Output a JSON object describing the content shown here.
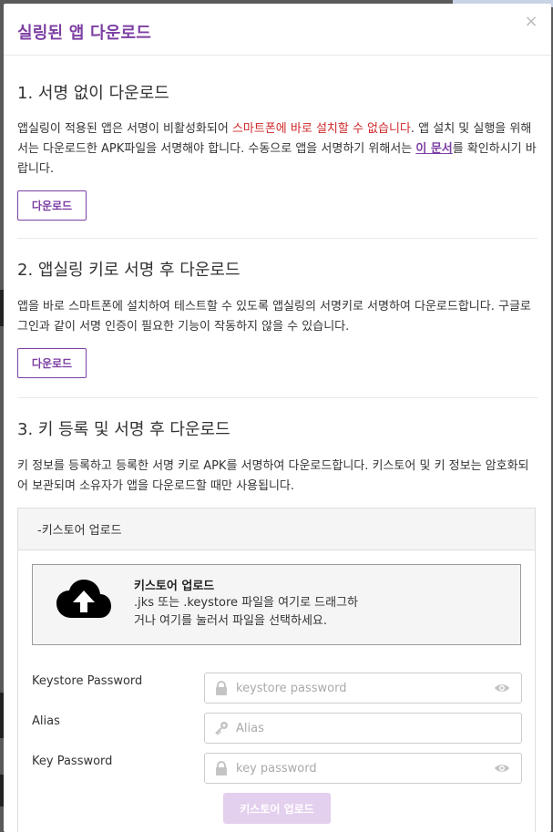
{
  "modal": {
    "title": "실링된 앱 다운로드",
    "close_symbol": "×"
  },
  "section1": {
    "heading": "1. 서명 없이 다운로드",
    "text_a": "앱실링이 적용된 앱은 서명이 비활성화되어 ",
    "text_red": "스마트폰에 바로 설치할 수 없습니다",
    "text_b": ". 앱 설치 및 실행을 위해서는 다운로드한 APK파일을 서명해야 합니다. 수동으로 앱을 서명하기 위해서는 ",
    "link": "이 문서",
    "text_c": "를 확인하시기 바랍니다.",
    "button": "다운로드"
  },
  "section2": {
    "heading": "2. 앱실링 키로 서명 후 다운로드",
    "text": "앱을 바로 스마트폰에 설치하여 테스트할 수 있도록 앱실링의 서명키로 서명하여 다운로드합니다. 구글로그인과 같이 서명 인증이 필요한 기능이 작동하지 않을 수 있습니다.",
    "button": "다운로드"
  },
  "section3": {
    "heading": "3. 키 등록 및 서명 후 다운로드",
    "text": "키 정보를 등록하고 등록한 서명 키로 APK를 서명하여 다운로드합니다. 키스토어 및 키 정보는 암호화되어 보관되며 소유자가 앱을 다운로드할 때만 사용됩니다."
  },
  "keystore_panel": {
    "header": "-키스토어 업로드",
    "dropzone_title": "키스토어 업로드",
    "dropzone_line1": ".jks 또는 .keystore 파일을 여기로 드래그하",
    "dropzone_line2": "거나 여기를 눌러서 파일을 선택하세요.",
    "fields": {
      "keystore_password": {
        "label": "Keystore Password",
        "placeholder": "keystore password",
        "icon": "lock-icon"
      },
      "alias": {
        "label": "Alias",
        "placeholder": "Alias",
        "icon": "key-icon"
      },
      "key_password": {
        "label": "Key Password",
        "placeholder": "key password",
        "icon": "lock-icon"
      }
    },
    "submit": "키스토어 업로드"
  },
  "colors": {
    "accent": "#7c3fa3",
    "warning_text": "#d0282a",
    "disabled_button": "#e3cfee"
  }
}
